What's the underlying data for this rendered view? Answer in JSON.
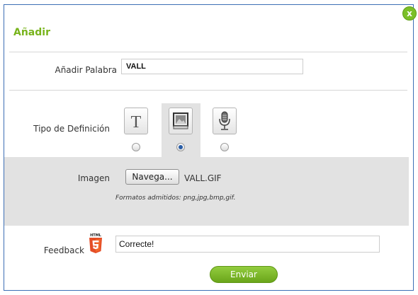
{
  "dialog": {
    "title": "Añadir",
    "close_label": "x"
  },
  "word": {
    "label": "Añadir Palabra",
    "value": "VALL"
  },
  "definition_type": {
    "label": "Tipo de Definición",
    "options": [
      {
        "icon": "text-icon",
        "selected": false
      },
      {
        "icon": "image-icon",
        "selected": true
      },
      {
        "icon": "microphone-icon",
        "selected": false
      }
    ]
  },
  "image": {
    "label": "Imagen",
    "browse_label": "Navega...",
    "file_name": "VALL.GIF",
    "formats_note": "Formatos admitidos: png,jpg,bmp,gif."
  },
  "feedback": {
    "label": "Feedback",
    "badge_icon": "html5-icon",
    "value": "Correcte!"
  },
  "submit": {
    "label": "Enviar"
  },
  "colors": {
    "accent_green": "#78b41c",
    "border_blue": "#3d6fb5",
    "panel_gray": "#e2e2e2"
  }
}
